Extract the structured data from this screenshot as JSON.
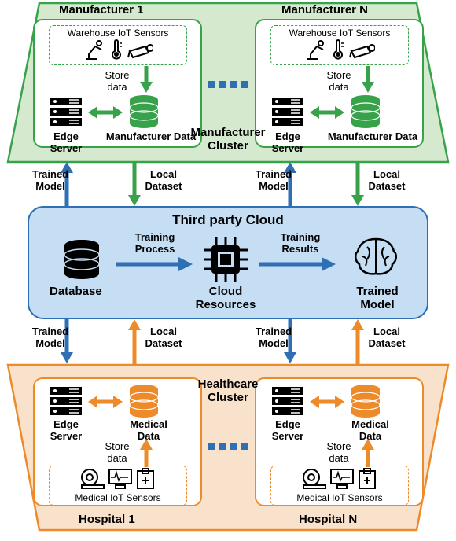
{
  "manufacturerCluster": {
    "title": "Manufacturer Cluster",
    "nodes": [
      {
        "title": "Manufacturer 1",
        "iotLabel": "Warehouse IoT Sensors",
        "storeData": "Store data",
        "edgeServer": "Edge Server",
        "dataLabel": "Manufacturer Data"
      },
      {
        "title": "Manufacturer N",
        "iotLabel": "Warehouse IoT Sensors",
        "storeData": "Store data",
        "edgeServer": "Edge Server",
        "dataLabel": "Manufacturer Data"
      }
    ]
  },
  "healthcareCluster": {
    "title": "Healthcare Cluster",
    "nodes": [
      {
        "title": "Hospital 1",
        "iotLabel": "Medical IoT Sensors",
        "storeData": "Store data",
        "edgeServer": "Edge Server",
        "dataLabel": "Medical Data"
      },
      {
        "title": "Hospital N",
        "iotLabel": "Medical IoT Sensors",
        "storeData": "Store data",
        "edgeServer": "Edge Server",
        "dataLabel": "Medical Data"
      }
    ]
  },
  "cloud": {
    "title": "Third party Cloud",
    "database": "Database",
    "trainingProcess": "Training Process",
    "cloudResources": "Cloud Resources",
    "trainingResults": "Training Results",
    "trainedModel": "Trained Model"
  },
  "arrows": {
    "trainedModel": "Trained Model",
    "localDataset": "Local Dataset"
  },
  "colors": {
    "greenFill": "#d4e9ce",
    "greenStroke": "#38a24a",
    "orangeFill": "#f9e2cc",
    "orangeStroke": "#ed8b2a",
    "blueFill": "#c5def4",
    "blueStroke": "#2f6fb4"
  }
}
